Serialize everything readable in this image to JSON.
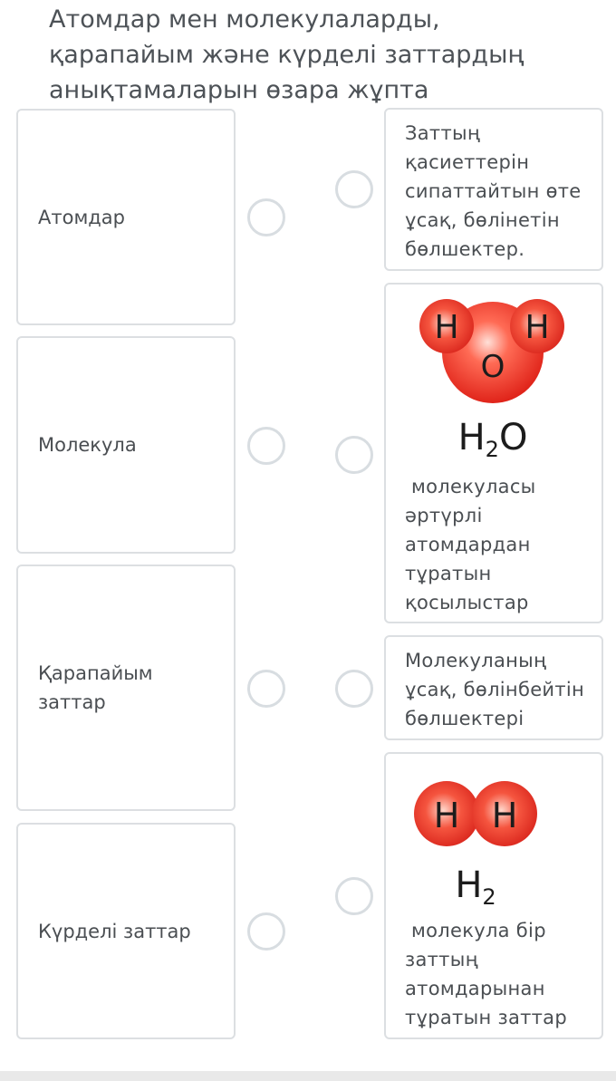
{
  "title": "Атомдар мен молекулаларды, қарапайым және күрделі заттардың анықтамаларын өзара жұпта",
  "left_items": [
    {
      "label": "Атомдар"
    },
    {
      "label": "Молекула"
    },
    {
      "label": "Қарапайым заттар"
    },
    {
      "label": "Күрделі заттар"
    }
  ],
  "right_items": [
    {
      "text": "Заттың қасиеттерін сипаттайтын өте ұсақ, бөлінетін бөлшектер."
    },
    {
      "text": "молекуласы әртүрлі атомдардан тұратын қосылыстар",
      "image": {
        "icon": "water-molecule-icon",
        "atoms": [
          "H",
          "O",
          "H"
        ],
        "formula_base": "H",
        "formula_sub": "2",
        "formula_tail": "O"
      }
    },
    {
      "text": "Молекуланың ұсақ, бөлінбейтін бөлшектері"
    },
    {
      "text": "молекула бір заттың атомдарынан тұратын заттар",
      "image": {
        "icon": "hydrogen-molecule-icon",
        "atoms": [
          "H",
          "H"
        ],
        "formula_base": "H",
        "formula_sub": "2",
        "formula_tail": ""
      }
    }
  ],
  "colors": {
    "atom_red": "#e8382c",
    "atom_highlight": "#ffd2c8",
    "border": "#dcdfe2",
    "radio_border": "#d8dde1",
    "text": "#4a4e52"
  }
}
